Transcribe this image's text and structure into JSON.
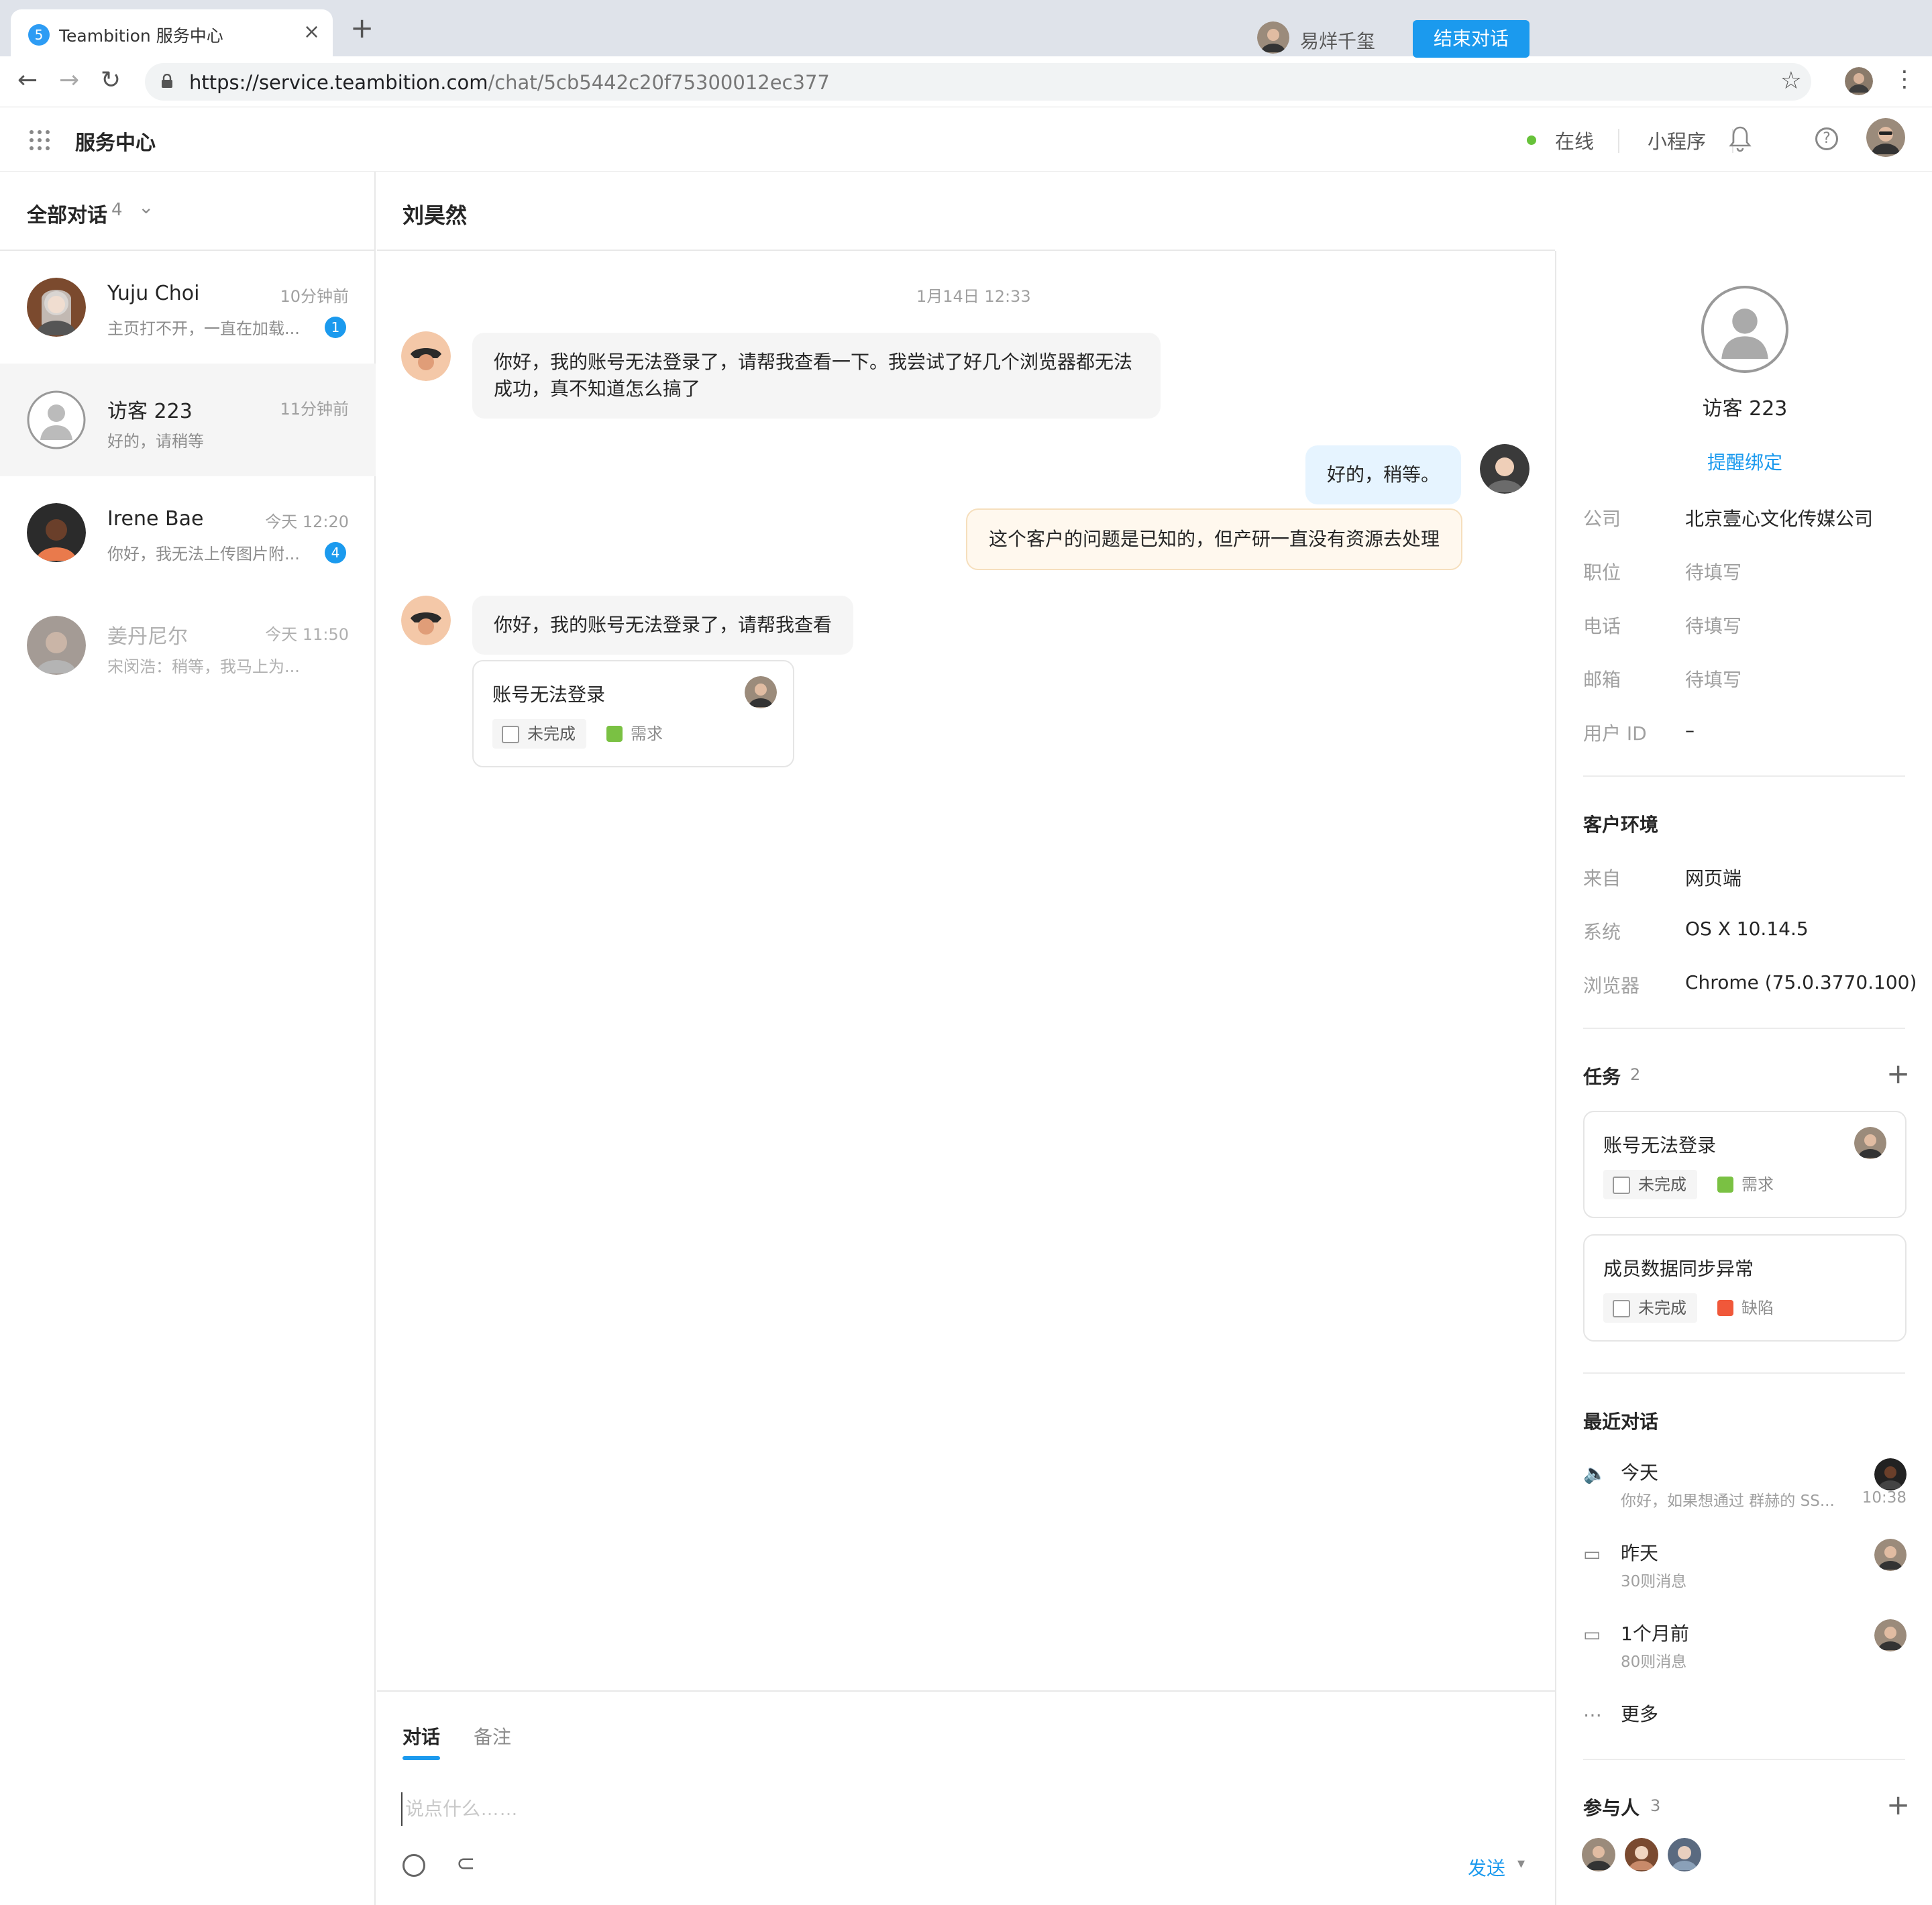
{
  "browser": {
    "tab_title": "Teambition 服务中心",
    "tab_favicon": "5",
    "url_host": "https://service.teambition.com",
    "url_path": "/chat/5cb5442c20f75300012ec377"
  },
  "header": {
    "app_title": "服务中心",
    "status": "在线",
    "mini_program": "小程序"
  },
  "conversation_list": {
    "filter_label": "全部对话",
    "filter_count": "4",
    "items": [
      {
        "name": "Yuju Choi",
        "time": "10分钟前",
        "preview": "主页打不开，一直在加载...",
        "badge": "1"
      },
      {
        "name": "访客 223",
        "time": "11分钟前",
        "preview": "好的，请稍等",
        "badge": ""
      },
      {
        "name": "Irene Bae",
        "time": "今天 12:20",
        "preview": "你好，我无法上传图片附...",
        "badge": "4"
      },
      {
        "name": "姜丹尼尔",
        "time": "今天 11:50",
        "preview": "宋闵浩：稍等，我马上为...",
        "badge": ""
      }
    ]
  },
  "chat": {
    "title": "刘昊然",
    "assignee": "易烊千玺",
    "end_button": "结束对话",
    "date": "1月14日 12:33",
    "messages": [
      {
        "side": "left",
        "text": "你好，我的账号无法登录了，请帮我查看一下。我尝试了好几个浏览器都无法成功，真不知道怎么搞了"
      },
      {
        "side": "right",
        "text": "好的，稍等。"
      },
      {
        "side": "note",
        "text": "这个客户的问题是已知的，但产研一直没有资源去处理"
      },
      {
        "side": "left",
        "text": "你好，我的账号无法登录了，请帮我查看"
      }
    ],
    "task_card": {
      "title": "账号无法登录",
      "status": "未完成",
      "type": "需求"
    },
    "composer": {
      "tab_chat": "对话",
      "tab_note": "备注",
      "placeholder": "说点什么……",
      "send": "发送"
    }
  },
  "customer": {
    "name": "访客 223",
    "bind_link": "提醒绑定",
    "fields": [
      {
        "label": "公司",
        "value": "北京壹心文化传媒公司"
      },
      {
        "label": "职位",
        "value": "待填写"
      },
      {
        "label": "电话",
        "value": "待填写"
      },
      {
        "label": "邮箱",
        "value": "待填写"
      },
      {
        "label": "用户 ID",
        "value": "–"
      }
    ],
    "env_title": "客户环境",
    "env": [
      {
        "label": "来自",
        "value": "网页端"
      },
      {
        "label": "系统",
        "value": "OS X 10.14.5"
      },
      {
        "label": "浏览器",
        "value": "Chrome (75.0.3770.100)"
      }
    ],
    "tasks_title": "任务",
    "tasks_count": "2",
    "tasks": [
      {
        "title": "账号无法登录",
        "status": "未完成",
        "type": "需求",
        "type_color": "#7ac143"
      },
      {
        "title": "成员数据同步异常",
        "status": "未完成",
        "type": "缺陷",
        "type_color": "#f0583a"
      }
    ],
    "recent_title": "最近对话",
    "recent": [
      {
        "title": "今天",
        "sub": "你好，如果想通过 群赫的 SS...",
        "time": "10:38",
        "icon": "speaker-icon"
      },
      {
        "title": "昨天",
        "sub": "30则消息",
        "time": "",
        "icon": "chat-bubble-icon"
      },
      {
        "title": "1个月前",
        "sub": "80则消息",
        "time": "",
        "icon": "chat-bubble-icon"
      }
    ],
    "more": "更多",
    "participants_title": "参与人",
    "participants_count": "3"
  },
  "colors": {
    "accent": "#1b9aee",
    "online": "#67c23a",
    "note_bg": "#fff8ee"
  }
}
